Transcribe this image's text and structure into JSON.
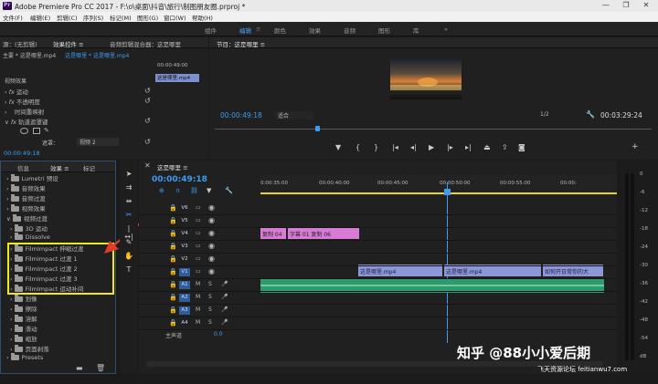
{
  "titlebar": {
    "title": "Adobe Premiere Pro CC 2017 - F:\\o\\桌面\\抖音\\旅行\\制图朋友圈.prproj *",
    "minimize": "—",
    "maximize": "❐",
    "close": "✕"
  },
  "menubar": [
    "文件(F)",
    "编辑(E)",
    "剪辑(C)",
    "序列(S)",
    "标记(M)",
    "图形(G)",
    "窗口(W)",
    "帮助(H)"
  ],
  "workspaces": [
    "组件",
    "编辑",
    "颜色",
    "效果",
    "音频",
    "图形",
    "库"
  ],
  "workspace_more": "»",
  "source_panel": {
    "tabs": [
      "源：(无剪辑)",
      "效果控件 ≡",
      "音频剪辑混合器：这是哪里"
    ],
    "master": "主要 * 这是哪里.mp4",
    "seq": "这是哪里 * 这是哪里.mp4",
    "clip": "这是哪里.mp4",
    "mini_time": "00:00:49:00",
    "video_fx": "视频效果",
    "fx": [
      "运动",
      "不透明度",
      "时间重映射",
      "轨道遮罩键"
    ],
    "fx_sub_label": "遮罩：",
    "fx_sub_value": "视频 2",
    "timecode": "00:00:49:18"
  },
  "program": {
    "title": "节目：这是哪里 ≡",
    "timecode": "00:00:49:18",
    "fit": "适合",
    "ratio": "1/2",
    "duration": "00:03:29:24"
  },
  "effects_panel": {
    "tabs": [
      "信息",
      "效果 ≡",
      "标记"
    ],
    "items": [
      "Lumetri 预设",
      "音频效果",
      "音频过渡",
      "视频效果",
      "视频过渡",
      "3D 运动",
      "Dissolve",
      "FilmImpact 伸缩过渡",
      "FilmImpact 过渡 1",
      "FilmImpact 过渡 2",
      "FilmImpact 过渡 3",
      "FilmImpact 运动补间",
      "划像",
      "擦除",
      "溶解",
      "滑动",
      "缩放",
      "页面剥落",
      "Presets"
    ]
  },
  "timeline": {
    "tab": "这是哪里 ≡",
    "timecode": "00:00:49:18",
    "ruler": [
      "0:00:35:00",
      "00:00:40:00",
      "00:00:45:00",
      "00:00:50:00",
      "00:00:55:00",
      "00:00:"
    ],
    "video_tracks": [
      "V6",
      "V5",
      "V4",
      "V3",
      "V2",
      "V1"
    ],
    "audio_tracks": [
      "A1",
      "A2",
      "A3",
      "A4"
    ],
    "master_label": "主声道",
    "master_value": "0.0",
    "clips": {
      "pink1": "复制 04",
      "pink2": "字幕 01 复制 06",
      "v1a": "这是哪里.mp4",
      "v1b": "这是哪里.mp4",
      "v1c": "如何开日常你的大"
    }
  },
  "meters": [
    "0",
    "-6",
    "-12",
    "-18",
    "-24",
    "-30",
    "-36",
    "-42",
    "-48",
    "-54",
    "dB"
  ],
  "watermark": {
    "main": "知乎 @88小小爱后期",
    "sub": "飞天资源论坛 feitianwu7.com"
  },
  "colors": {
    "accent": "#3d9cf0",
    "highlight": "#f2e81a",
    "arrow": "#e23b2a",
    "clip_pink": "#d77bd6",
    "clip_blue": "#8c97d8",
    "audio": "#2f9a6e"
  }
}
